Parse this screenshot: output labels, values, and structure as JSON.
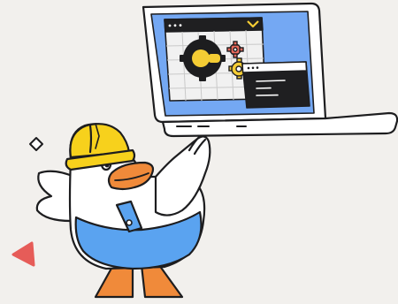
{
  "illustration": {
    "subject": "duck-construction-worker-with-laptop",
    "icons": [
      "laptop-icon",
      "browser-window-icon",
      "terminal-window-icon",
      "gear-icon",
      "yellow-gear-icon",
      "red-gear-icon",
      "hard-hat-icon",
      "sparkle-diamond-icon",
      "triangle-icon"
    ]
  },
  "colors": {
    "background": "#f2f0ed",
    "outline": "#1d1d1f",
    "laptop_body": "#ffffff",
    "laptop_screen": "#74a8f3",
    "browser_bg": "#f1f1f1",
    "grid_line": "#c9c9c9",
    "terminal_bg": "#1f1f21",
    "terminal_text": "#ffffff",
    "gear_yellow": "#f4cc34",
    "gear_red": "#ea6a5c",
    "duck_white": "#ffffff",
    "duck_beak": "#f08a3a",
    "overalls_blue": "#5aa3f0",
    "hat_yellow": "#f7d11c",
    "triangle_red": "#e65c58",
    "diamond": "#ffffff"
  }
}
